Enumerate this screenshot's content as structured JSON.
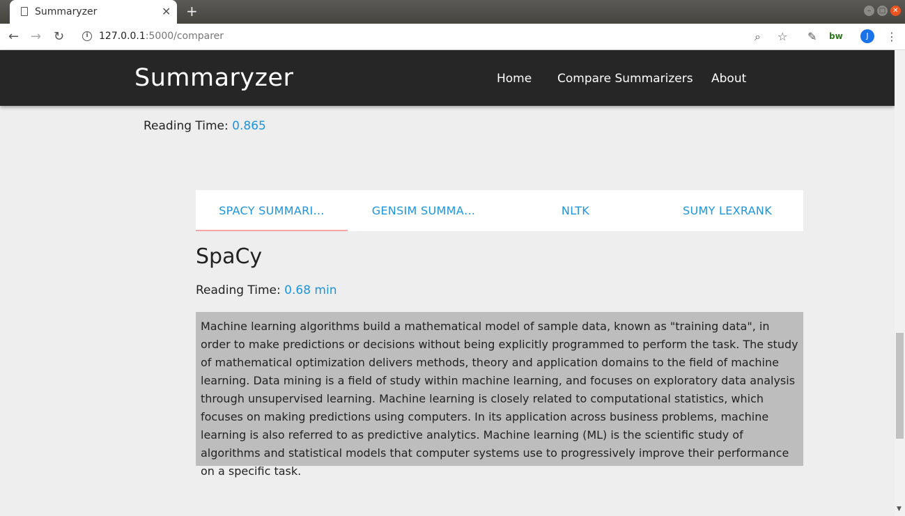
{
  "browser": {
    "tab_title": "Summaryzer",
    "url_host": "127.0.0.1",
    "url_path": ":5000/comparer",
    "new_tab_symbol": "+",
    "close_tab_symbol": "✕",
    "extension_label": "bw",
    "profile_initial": "J"
  },
  "site": {
    "brand": "Summaryzer",
    "nav": [
      "Home",
      "Compare Summarizers",
      "About"
    ]
  },
  "original": {
    "reading_time_label": "Reading Time:",
    "reading_time_value": "0.865"
  },
  "tabs": [
    {
      "label": "SPACY SUMMARI…",
      "active": true
    },
    {
      "label": "GENSIM SUMMA…",
      "active": false
    },
    {
      "label": "NLTK",
      "active": false
    },
    {
      "label": "SUMY LEXRANK",
      "active": false
    }
  ],
  "panel": {
    "heading": "SpaCy",
    "reading_time_label": "Reading Time:",
    "reading_time_value": "0.68 min",
    "summary": "Machine learning algorithms build a mathematical model of sample data, known as \"training data\", in order to make predictions or decisions without being explicitly programmed to perform the task. The study of mathematical optimization delivers methods, theory and application domains to the field of machine learning. Data mining is a field of study within machine learning, and focuses on exploratory data analysis through unsupervised learning. Machine learning is closely related to computational statistics, which focuses on making predictions using computers. In its application across business problems, machine learning is also referred to as predictive analytics. Machine learning (ML) is the scientific study of algorithms and statistical models that computer systems use to progressively improve their performance on a specific task."
  },
  "colors": {
    "accent": "#1b95e0",
    "header_bg": "#262626",
    "summary_bg": "#bdbdbd",
    "tab_indicator": "#f6a5a5"
  }
}
